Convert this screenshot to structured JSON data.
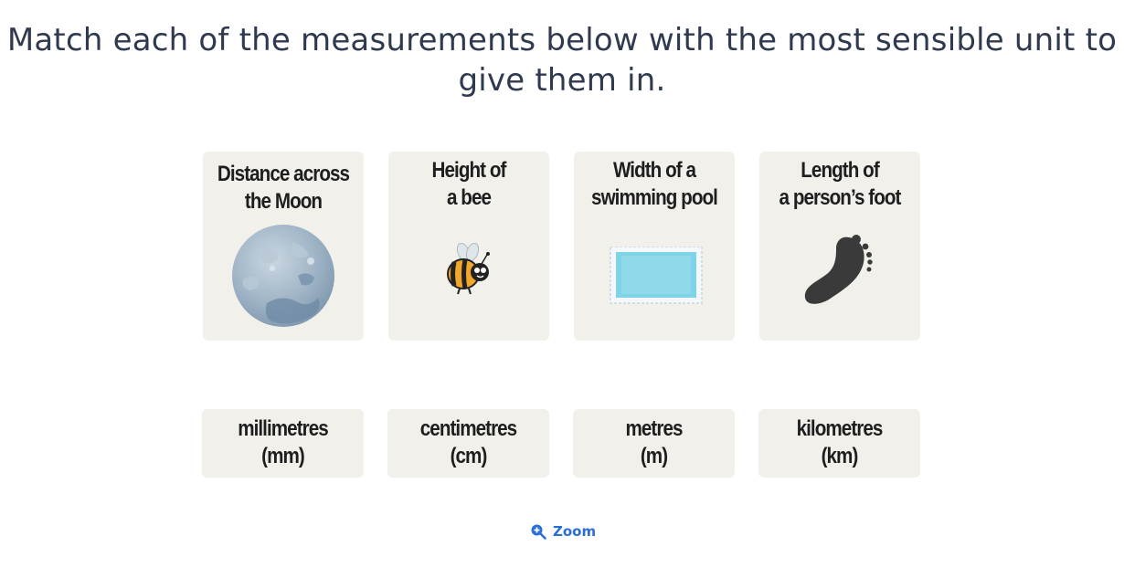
{
  "question": "Match each of the measurements below with the most sensible unit to give them in.",
  "prompts": [
    {
      "label": "Distance across\nthe Moon",
      "icon": "moon-icon"
    },
    {
      "label": "Height of\na bee",
      "icon": "bee-icon"
    },
    {
      "label": "Width of a\nswimming pool",
      "icon": "swimming-pool-icon"
    },
    {
      "label": "Length of\na person’s foot",
      "icon": "footprint-icon"
    }
  ],
  "units": [
    {
      "label": "millimetres\n(mm)"
    },
    {
      "label": "centimetres\n(cm)"
    },
    {
      "label": "metres\n(m)"
    },
    {
      "label": "kilometres\n(km)"
    }
  ],
  "zoom": {
    "label": "Zoom",
    "icon": "zoom-in-icon"
  },
  "colors": {
    "question_text": "#2f3a4f",
    "card_background": "#f2f0eb",
    "link": "#2a6fd6"
  }
}
